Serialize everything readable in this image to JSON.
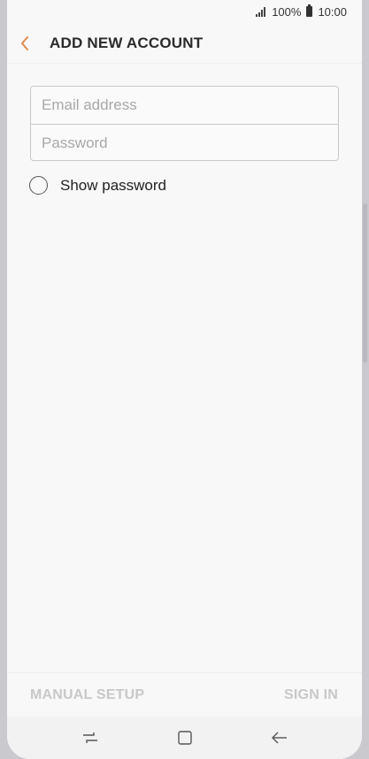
{
  "status_bar": {
    "battery": "100%",
    "time": "10:00"
  },
  "header": {
    "title": "ADD NEW ACCOUNT"
  },
  "form": {
    "email_placeholder": "Email address",
    "email_value": "",
    "password_placeholder": "Password",
    "password_value": "",
    "show_password_label": "Show password",
    "show_password_checked": false
  },
  "actions": {
    "manual_setup": "MANUAL SETUP",
    "sign_in": "SIGN IN"
  },
  "nav": {
    "recents_icon": "recent-apps-icon",
    "home_icon": "home-icon",
    "back_icon": "back-arrow-icon"
  },
  "colors": {
    "accent": "#e88a4a",
    "disabled": "#c8c8c8",
    "text": "#2b2b2b"
  }
}
